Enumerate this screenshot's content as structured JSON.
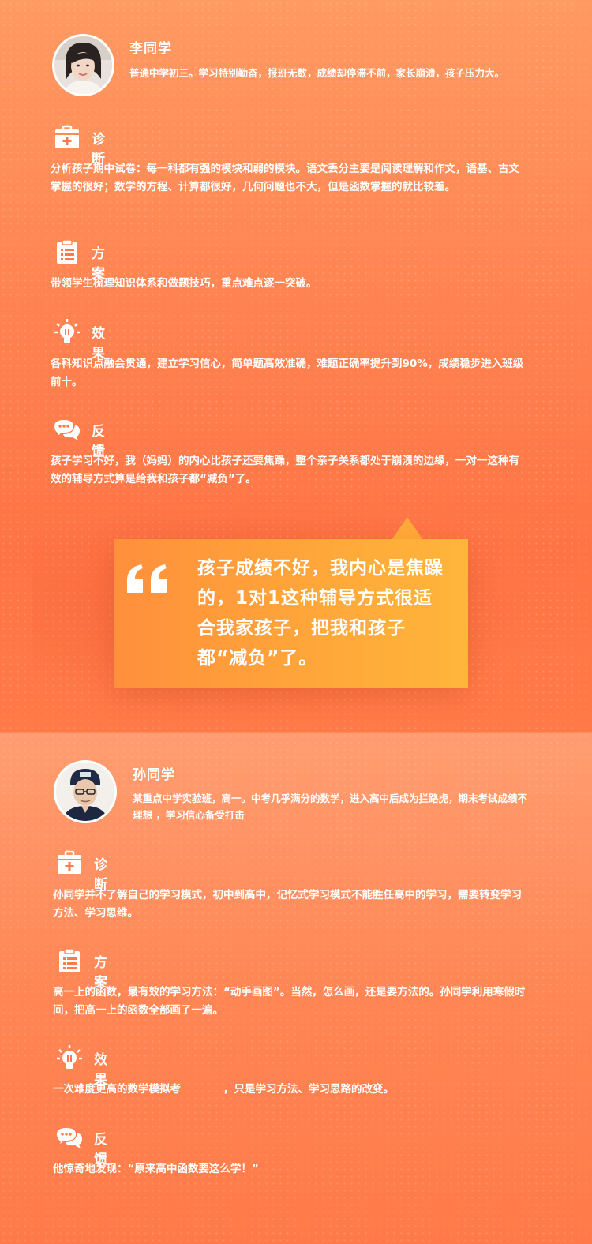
{
  "student1": {
    "name": "李同学",
    "intro": "普通中学初三。学习特别勤奋，报班无数，成绩却停滞不前，家长崩溃，孩子压力大。",
    "diagnosis": {
      "title": "诊断",
      "icon": "medical-kit-icon",
      "text": "分析孩子期中试卷：每一科都有强的模块和弱的模块。语文丢分主要是阅读理解和作文，语基、古文掌握的很好；数学的方程、计算都很好，几何问题也不大，但是函数掌握的就比较差。"
    },
    "plan": {
      "title": "方案",
      "icon": "clipboard-icon",
      "text": "带领学生梳理知识体系和做题技巧，重点难点逐一突破。"
    },
    "effect": {
      "title": "效果",
      "icon": "lightbulb-icon",
      "text": "各科知识点融会贯通，建立学习信心，简单题高效准确，难题正确率提升到90%，成绩稳步进入班级前十。"
    },
    "feedback": {
      "title": "反馈",
      "icon": "chat-bubbles-icon",
      "text": "孩子学习不好，我（妈妈）的内心比孩子还要焦躁，整个亲子关系都处于崩溃的边缘，一对一这种有效的辅导方式算是给我和孩子都“减负”了。"
    },
    "quote": "孩子成绩不好，我内心是焦躁的，1对1这种辅导方式很适合我家孩子，把我和孩子都“减负”了。"
  },
  "student2": {
    "name": "孙同学",
    "intro": "某重点中学实验班，高一。中考几乎满分的数学，进入高中后成为拦路虎，期末考试成绩不理想 ，学习信心备受打击",
    "diagnosis": {
      "title": "诊断",
      "icon": "medical-kit-icon",
      "text": "孙同学并不了解自己的学习模式，初中到高中，记忆式学习模式不能胜任高中的学习，需要转变学习方法、学习思维。"
    },
    "plan": {
      "title": "方案",
      "icon": "clipboard-icon",
      "text": "高一上的函数，最有效的学习方法：“动手画图”。当然，怎么画，还是要方法的。孙同学利用寒假时间，把高一上的函数全部画了一遍。"
    },
    "effect": {
      "title": "效果",
      "icon": "lightbulb-icon",
      "text": "一次难度更高的数学模拟考　　　　，只是学习方法、学习思路的改变。"
    },
    "feedback": {
      "title": "反馈",
      "icon": "chat-bubbles-icon",
      "text": "他惊奇地发现：“原来高中函数要这么学！”"
    }
  },
  "colors": {
    "accent": "#ff7a4a",
    "quote_box": "#ffa83a",
    "text": "#ffffff"
  }
}
